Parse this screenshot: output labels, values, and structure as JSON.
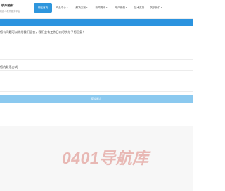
{
  "header": {
    "logo_title": "杭州骆村",
    "logo_subtitle": "机器人教育服务平台",
    "nav": [
      {
        "label": "网站首页",
        "active": true,
        "has_arrow": false
      },
      {
        "label": "产品中心",
        "active": false,
        "has_arrow": true
      },
      {
        "label": "解决方案",
        "active": false,
        "has_arrow": true
      },
      {
        "label": "新闻资讯",
        "active": false,
        "has_arrow": true
      },
      {
        "label": "用户案例",
        "active": false,
        "has_arrow": true
      },
      {
        "label": "技术支持",
        "active": false,
        "has_arrow": false
      },
      {
        "label": "关于我们",
        "active": false,
        "has_arrow": true
      }
    ]
  },
  "form": {
    "lead_text": "您有问题可以先给我们留言，我们会有工作日内尽快给予您回复！",
    "message_value": "",
    "contact_label": "您的联系方式",
    "contact_value": "",
    "extra_value": "",
    "submit_label": "提交留言"
  },
  "footer": {
    "brand_text": "0401导航库"
  },
  "colors": {
    "accent": "#2b93df",
    "submit": "#8bc9ef",
    "brand": "#e8b8b4"
  }
}
